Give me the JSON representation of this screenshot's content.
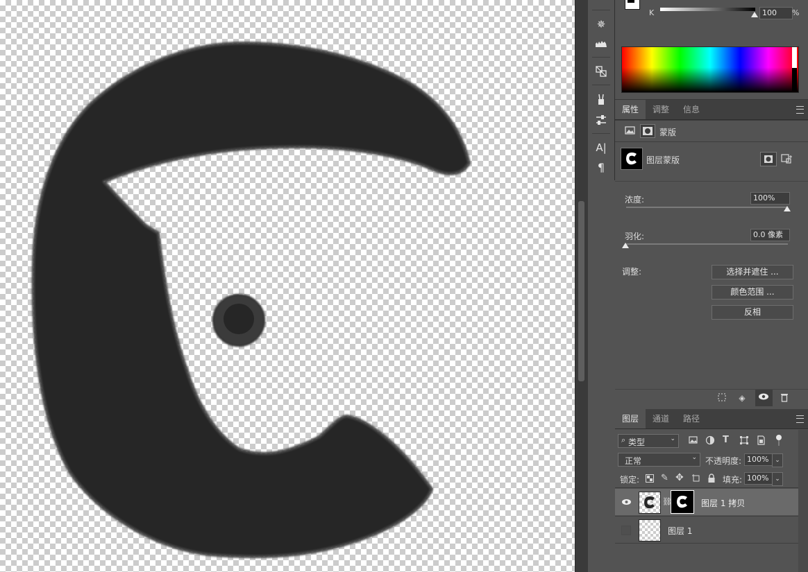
{
  "color_panel": {
    "channel_label": "K",
    "k_value": "100",
    "percent_sign": "%"
  },
  "tools": {
    "icons": [
      "color-brush-icon",
      "histogram-icon",
      "3d-material-icon",
      "brush-presets-icon",
      "adjust-sliders-icon",
      "character-icon",
      "paragraph-icon"
    ]
  },
  "properties_panel": {
    "tabs": [
      "属性",
      "调整",
      "信息"
    ],
    "active_tab": "属性",
    "mask_type_label": "蒙版",
    "mask_title": "图层蒙版",
    "density_label": "浓度:",
    "density_value": "100%",
    "density_level": 1.0,
    "feather_label": "羽化:",
    "feather_value": "0.0 像素",
    "feather_level": 0.0,
    "adjust_label": "调整:",
    "buttons": {
      "select_and_mask": "选择并遮住 ...",
      "color_range": "颜色范围 ...",
      "invert": "反相"
    }
  },
  "layers_panel": {
    "tabs": [
      "图层",
      "通道",
      "路径"
    ],
    "active_tab": "图层",
    "filter_kind": "类型",
    "blend_mode": "正常",
    "opacity_label": "不透明度:",
    "opacity_value": "100%",
    "lock_label": "锁定:",
    "fill_label": "填充:",
    "fill_value": "100%",
    "layers": [
      {
        "name": "图层 1 拷贝",
        "visible": true,
        "selected": true,
        "has_mask": true
      },
      {
        "name": "图层 1",
        "visible": false,
        "selected": false,
        "has_mask": false
      }
    ]
  },
  "colors": {
    "panel_bg": "#535353",
    "tab_bar_bg": "#3f3f3f",
    "selected_layer_bg": "#6a6a6a",
    "canvas_shape": "#262626"
  }
}
